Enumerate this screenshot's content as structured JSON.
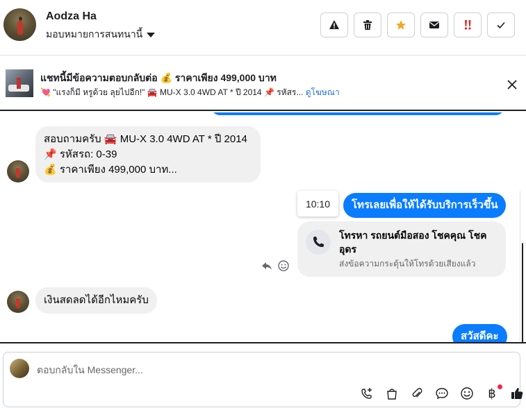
{
  "header": {
    "user_name": "Aodza Ha",
    "assign_label": "มอบหมายการสนทนานี้",
    "buttons": [
      {
        "name": "warning",
        "icon": "alert-triangle-icon"
      },
      {
        "name": "delete",
        "icon": "trash-icon"
      },
      {
        "name": "star",
        "icon": "star-icon"
      },
      {
        "name": "mark-unread",
        "icon": "envelope-icon"
      },
      {
        "name": "important",
        "icon": "double-exclamation-icon"
      },
      {
        "name": "done",
        "icon": "check-icon"
      }
    ]
  },
  "banner": {
    "title": "แชทนี้มีข้อความตอบกลับต่อ 💰 ราคาเพียง 499,000 บาท",
    "subtitle": "💘 \"แรงก็มี หรูด้วย ลุยไปอีก!\" 🚘 MU-X 3.0 4WD AT * ปี 2014 📌 รหัสร...",
    "link": "ดูโฆษณา"
  },
  "messages": {
    "inquiry_lines": [
      "สอบถามครับ 🚘 MU-X 3.0 4WD AT * ปี 2014",
      "📌 รหัสรถ: 0-39",
      "💰 ราคาเพียง 499,000 บาท..."
    ],
    "time": "10:10",
    "outgoing_call_prompt": "โทรเลยเพื่อให้ได้รับบริการเร็วขึ้น",
    "call_card_title": "โทรหา รถยนต์มือสอง โชคคุณ โชค อุดร",
    "call_card_sub": "ส่งข้อความกระตุ้นให้โทรด้วยเสียงแล้ว",
    "incoming_question": "เงินสดลดได้อีกไหมครับ",
    "outgoing_greeting": "สวัสดีคะ"
  },
  "composer": {
    "placeholder": "ตอบกลับใน Messenger...",
    "baht_symbol": "฿",
    "tools": [
      "phone-plus-icon",
      "shopping-bag-icon",
      "paperclip-icon",
      "saved-reply-icon",
      "emoji-icon",
      "baht-icon",
      "thumbs-up-icon"
    ]
  },
  "colors": {
    "accent": "#0a7cff",
    "link": "#216fdb",
    "star": "#f5a623",
    "alert_red": "#e02424"
  }
}
